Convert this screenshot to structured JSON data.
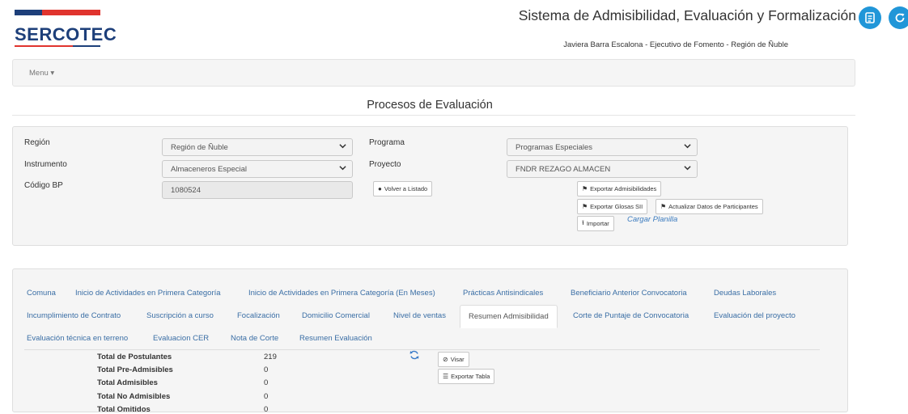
{
  "header": {
    "logo_text": "SERCOTEC",
    "system_title": "Sistema de Admisibilidad, Evaluación y Formalización",
    "user_info": "Javiera Barra Escalona  - Ejecutivo de Fomento  - Región de Ñuble",
    "icons": [
      "document-list-icon",
      "refresh-circle-icon"
    ],
    "colors": {
      "brand_blue": "#1d3f7a",
      "brand_red": "#e0342e",
      "accent": "#2196d8"
    }
  },
  "nav": {
    "menu_label": "Menu"
  },
  "page": {
    "title": "Procesos de Evaluación"
  },
  "filters": {
    "region_label": "Región",
    "region_value": "Región de Ñuble",
    "instrumento_label": "Instrumento",
    "instrumento_value": "Almaceneros Especial",
    "codigo_label": "Código BP",
    "codigo_value": "1080524",
    "programa_label": "Programa",
    "programa_value": "Programas Especiales",
    "proyecto_label": "Proyecto",
    "proyecto_value": "FNDR REZAGO ALMACEN",
    "volver_label": "Volver a Listado",
    "exportar_admisibilidades_label": "Exportar Admisibilidades",
    "exportar_glosas_label": "Exportar Glosas SII",
    "actualizar_label": "Actualizar Datos de Participantes",
    "importar_label": "Importar",
    "cargar_planilla_label": "Cargar Planilla"
  },
  "tabs": {
    "row1": [
      "Comuna",
      "Inicio de Actividades en Primera Categoría",
      "Inicio de Actividades en Primera Categoría (En Meses)",
      "Prácticas Antisindicales",
      "Beneficiario Anterior Convocatoria",
      "Deudas Laborales"
    ],
    "row2": [
      "Incumplimiento de Contrato",
      "Suscripción a curso",
      "Focalización",
      "Domicilio Comercial",
      "Nivel de ventas",
      "Resumen Admisibilidad",
      "Corte de Puntaje de Convocatoria",
      "Evaluación del proyecto"
    ],
    "row3": [
      "Evaluación técnica en terreno",
      "Evaluacion CER",
      "Nota de Corte",
      "Resumen Evaluación"
    ],
    "active": "Resumen Admisibilidad"
  },
  "summary": {
    "rows": [
      {
        "label": "Total de Postulantes",
        "value": "219"
      },
      {
        "label": "Total Pre-Admisibles",
        "value": "0"
      },
      {
        "label": "Total Admisibles",
        "value": "0"
      },
      {
        "label": "Total No Admisibles",
        "value": "0"
      },
      {
        "label": "Total Omitidos",
        "value": "0"
      }
    ],
    "visar_label": "Visar",
    "exportar_tabla_label": "Exportar Tabla"
  }
}
